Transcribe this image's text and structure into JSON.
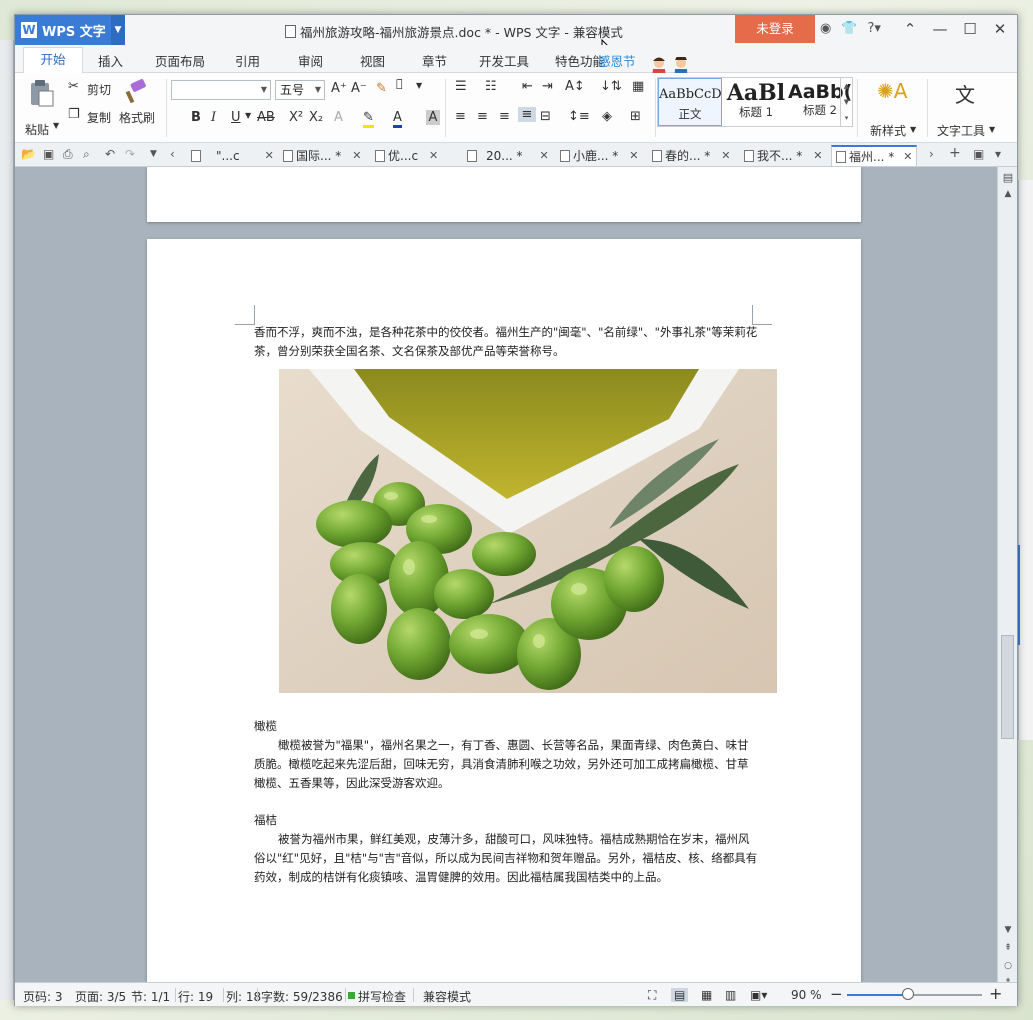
{
  "app": {
    "name": "WPS 文字",
    "window_title": "福州旅游攻略-福州旅游景点.doc * - WPS 文字 - 兼容模式",
    "login_label": "未登录"
  },
  "menu": {
    "tabs": [
      "开始",
      "插入",
      "页面布局",
      "引用",
      "审阅",
      "视图",
      "章节",
      "开发工具",
      "特色功能"
    ],
    "festival_text": "感恩节"
  },
  "ribbon": {
    "paste": "粘贴",
    "cut": "剪切",
    "copy": "复制",
    "format_painter": "格式刷",
    "font_name": "",
    "font_size": "五号",
    "styles": [
      {
        "sample": "AaBbCcD",
        "label": "正文"
      },
      {
        "sample": "AaBl",
        "label": "标题 1"
      },
      {
        "sample": "AaBb(",
        "label": "标题 2"
      }
    ],
    "new_style": "新样式",
    "text_tools": "文字工具"
  },
  "doc_tabs": [
    {
      "label": "\"...c"
    },
    {
      "label": "国际... *"
    },
    {
      "label": "优...c"
    },
    {
      "label": "20... *"
    },
    {
      "label": "小鹿... *"
    },
    {
      "label": "春的... *"
    },
    {
      "label": "我不... *"
    },
    {
      "label": "福州... *",
      "active": true
    }
  ],
  "document": {
    "para_top": "香而不浮，爽而不浊，是各种花茶中的佼佼者。福州生产的\"闽毫\"、\"名前绿\"、\"外事礼茶\"等茉莉花茶，曾分别荣获全国名茶、文名保茶及部优产品等荣誉称号。",
    "olive_heading": "橄榄",
    "olive_body": "橄榄被誉为\"福果\"，福州名果之一，有丁香、惠圆、长营等名品，果面青绿、肉色黄白、味甘质脆。橄榄吃起来先涩后甜，回味无穷，具消食清肺利喉之功效，另外还可加工成拷扁橄榄、甘草橄榄、五香果等，因此深受游客欢迎。",
    "tangerine_heading": "福桔",
    "tangerine_body": "被誉为福州市果，鲜红美观，皮薄汁多，甜酸可口，风味独特。福桔成熟期恰在岁末，福州风俗以\"红\"见好，且\"桔\"与\"吉\"音似，所以成为民间吉祥物和贺年赠品。另外，福桔皮、核、络都具有药效，制成的桔饼有化痰镇咳、温胃健脾的效用。因此福桔属我国桔类中的上品。"
  },
  "status": {
    "page_code": "页码: 3",
    "page": "页面: 3/5",
    "section": "节: 1/1",
    "row": "行: 19",
    "col": "列: 18",
    "word_count": "字数: 59/2386",
    "spell_check": "拼写检查",
    "compat_mode": "兼容模式",
    "zoom": "90 %",
    "zoom_fraction": 0.9
  },
  "colors": {
    "accent": "#3a7bd5",
    "login": "#e56b4a",
    "doc_bg": "#a9b3be"
  }
}
